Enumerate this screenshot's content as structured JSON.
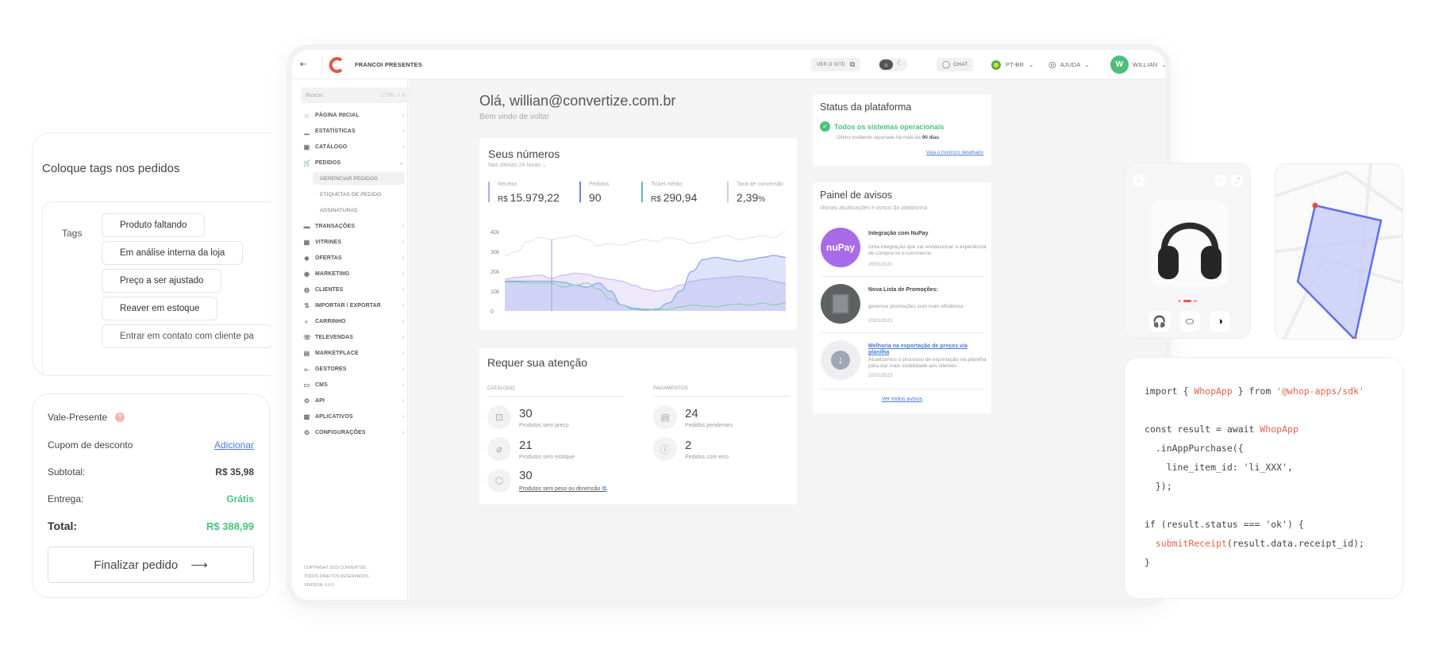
{
  "tags_card": {
    "title": "Coloque tags nos pedidos",
    "label": "Tags",
    "tags": [
      "Produto faltando",
      "Em análise interna da loja",
      "Preço a ser ajustado",
      "Reaver em estoque",
      "Entrar em contato com cliente pa"
    ]
  },
  "checkout": {
    "gift_label": "Vale-Presente",
    "help_glyph": "?",
    "coupon_label": "Cupom de desconto",
    "coupon_action": "Adicionar",
    "subtotal_label": "Subtotal:",
    "subtotal_value": "R$ 35,98",
    "delivery_label": "Entrega:",
    "delivery_value": "Grátis",
    "total_label": "Total:",
    "total_value": "R$ 388,99",
    "finish_label": "Finalizar pedido",
    "finish_arrow": "⟶"
  },
  "topbar": {
    "store_name": "FRANCOI PRESENTES",
    "view_site": "VER O SITE",
    "chat": "CHAT",
    "language": "PT-BR",
    "help": "AJUDA",
    "user_initial": "W",
    "user_name": "WILLIAN"
  },
  "sidebar": {
    "search_placeholder": "Buscar",
    "search_shortcut": "CTRL + K",
    "items": [
      "PÁGINA INICIAL",
      "ESTATÍSTICAS",
      "CATÁLOGO",
      "PEDIDOS",
      "TRANSAÇÕES",
      "VITRINES",
      "OFERTAS",
      "MARKETING",
      "CLIENTES",
      "IMPORTAR / EXPORTAR",
      "CARRINHO",
      "TELEVENDAS",
      "MARKETPLACE",
      "GESTORES",
      "CMS",
      "API",
      "APLICATIVOS",
      "CONFIGURAÇÕES"
    ],
    "subitems": [
      "GERENCIAR PEDIDOS",
      "ETIQUETAS DE PEDIDO",
      "ASSINATURAS"
    ],
    "footer": [
      "COPYRIGHT 2023 CONVERTIZE",
      "TODOS DIREITOS RESERVADOS.",
      "VERSION: 6.0.0"
    ]
  },
  "main": {
    "greeting": "Olá, willian@convertize.com.br",
    "welcome": "Bem vindo de volta!"
  },
  "numbers": {
    "title": "Seus números",
    "period": "Nas últimas 24 horas",
    "stats": [
      {
        "label": "Receita",
        "prefix": "R$",
        "value": "15.979,22",
        "suffix": "",
        "color": "#b7a6e6"
      },
      {
        "label": "Pedidos",
        "prefix": "",
        "value": "90",
        "suffix": "",
        "color": "#6d7fe0"
      },
      {
        "label": "Ticket médio",
        "prefix": "R$",
        "value": "290,94",
        "suffix": "",
        "color": "#5bc48f"
      },
      {
        "label": "Taxa de conversão",
        "prefix": "",
        "value": "2,39",
        "suffix": "%",
        "color": "#cfcfcf"
      }
    ]
  },
  "chart_data": {
    "type": "area",
    "ylim": [
      0,
      40000
    ],
    "yticks": [
      "40k",
      "30k",
      "20k",
      "10k",
      "0"
    ],
    "x": [
      0,
      1,
      2,
      3,
      4,
      5,
      6,
      7,
      8,
      9,
      10,
      11,
      12,
      13,
      14,
      15,
      16,
      17,
      18,
      19,
      20,
      21,
      22,
      23,
      24
    ],
    "series": [
      {
        "values": [
          28000,
          30000,
          35000,
          37000,
          36000,
          37000,
          38000,
          36000,
          33000,
          34000,
          33000,
          35000,
          36000,
          35000,
          37000,
          36000,
          34000,
          35000,
          37000,
          38000,
          36000,
          37000,
          38000,
          37000,
          40000
        ],
        "color": "#e6e6e6"
      },
      {
        "values": [
          16000,
          17000,
          17500,
          18000,
          16500,
          18000,
          19000,
          18500,
          17000,
          16000,
          15000,
          13000,
          11000,
          10000,
          11000,
          13000,
          15000,
          16000,
          16500,
          17000,
          17500,
          17000,
          16500,
          15000,
          14000
        ],
        "color": "#cbbdf0"
      },
      {
        "values": [
          15000,
          15000,
          15000,
          15000,
          15000,
          14500,
          13000,
          12000,
          14000,
          10000,
          3000,
          1000,
          500,
          1000,
          4000,
          10000,
          20000,
          26000,
          27000,
          26000,
          25000,
          26000,
          27000,
          28000,
          27000
        ],
        "color": "#8fa1ee"
      },
      {
        "values": [
          14500,
          14500,
          14000,
          14000,
          14000,
          12000,
          13000,
          14000,
          11000,
          6000,
          3000,
          1500,
          1000,
          500,
          800,
          2000,
          3000,
          2500,
          2000,
          3000,
          3500,
          3000,
          4000,
          3000,
          4000
        ],
        "color": "#8ed1b1"
      }
    ]
  },
  "attention": {
    "title": "Requer sua atenção",
    "catalog_label": "CATÁLOGO",
    "payments_label": "PAGAMENTOS",
    "catalog": [
      {
        "value": "30",
        "desc": "Produtos sem preço"
      },
      {
        "value": "21",
        "desc": "Produtos sem estoque"
      },
      {
        "value": "30",
        "desc": "Produtos sem peso ou dimensão"
      }
    ],
    "payments": [
      {
        "value": "24",
        "desc": "Pedidos pendentes"
      },
      {
        "value": "2",
        "desc": "Pedidos com erro"
      }
    ]
  },
  "status": {
    "title": "Status da plataforma",
    "ok": "Todos os sistemas operacionais",
    "incident_prefix": "Último incidente reportado há mais de",
    "incident_days": "90 dias",
    "history_link": "Veja o histórico detalhado"
  },
  "notices": {
    "title": "Painel de avisos",
    "subtitle": "últimas atualizações e avisos da plataforma",
    "items": [
      {
        "title": "Integração com NuPay",
        "desc": "Uma integração que vai revolucionar a experiência de compra no e-commerce.",
        "date": "20/01/2023",
        "logo": "nuPay"
      },
      {
        "title": "Nova Lista de Promoções:",
        "desc": "gerencie promoções com mais eficiência",
        "date": "20/01/2023"
      },
      {
        "title": "Melhoria na exportação de preços via planilha",
        "desc": "Atualizamos o processo de exportação via planilha para dar mais visibilidade aos clientes",
        "date": "20/01/2023"
      }
    ],
    "all_link": "Ver todos avisos"
  },
  "code": {
    "lines": [
      [
        [
          "k",
          "import { "
        ],
        [
          "f",
          "WhopApp"
        ],
        [
          "k",
          " } from "
        ],
        [
          "s",
          "'@whop-apps/sdk'"
        ]
      ],
      [],
      [
        [
          "k",
          "const result = await "
        ],
        [
          "f",
          "WhopApp"
        ]
      ],
      [
        [
          "k",
          "  .inAppPurchase({"
        ]
      ],
      [
        [
          "k",
          "    line_item_id: 'li_XXX',"
        ]
      ],
      [
        [
          "k",
          "  });"
        ]
      ],
      [],
      [
        [
          "k",
          "if (result.status === 'ok') {"
        ]
      ],
      [
        [
          "k",
          "  "
        ],
        [
          "f",
          "submitReceipt"
        ],
        [
          "k",
          "(result.data.receipt_id);"
        ]
      ],
      [
        [
          "k",
          "}"
        ]
      ]
    ]
  },
  "colors": {
    "brand": "#e8553f",
    "green": "#47c47a",
    "link": "#4a7bd8",
    "accent_purple": "#b386ea"
  }
}
